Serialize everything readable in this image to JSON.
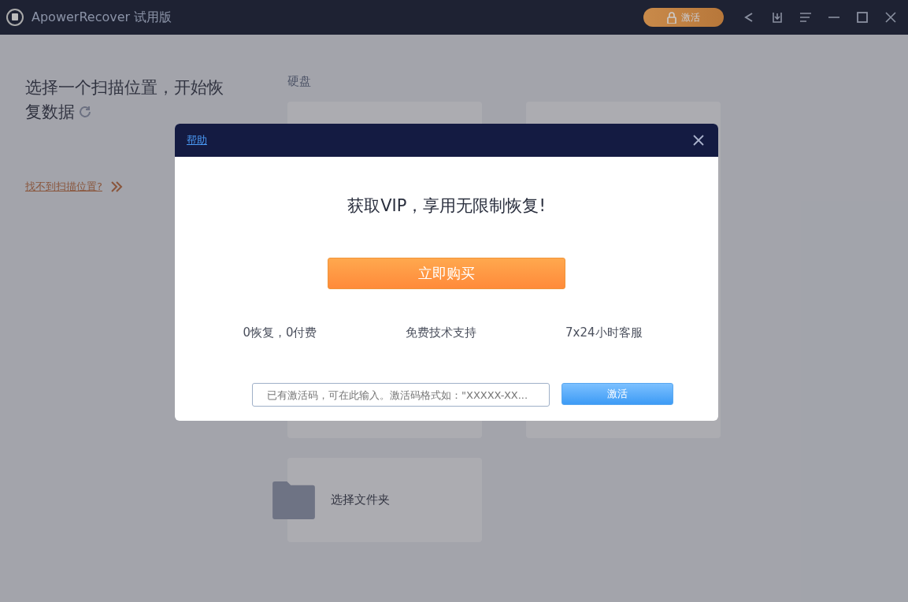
{
  "window": {
    "title": "ApowerRecover 试用版",
    "activate_button": "激活"
  },
  "sidebar": {
    "heading": "选择一个扫描位置，开始恢复数据",
    "help_link": "找不到扫描位置?"
  },
  "disks": {
    "label": "硬盘",
    "folder_card": "选择文件夹"
  },
  "dialog": {
    "help_link": "帮助",
    "headline": "获取VIP，享用无限制恢复!",
    "buy_button": "立即购买",
    "features": [
      "0恢复，0付费",
      "免费技术支持",
      "7x24小时客服"
    ],
    "code_field": {
      "placeholder": "已有激活码，可在此输入。激活码格式如：\"XXXXX-XX..."
    },
    "activate_button": "激活"
  }
}
